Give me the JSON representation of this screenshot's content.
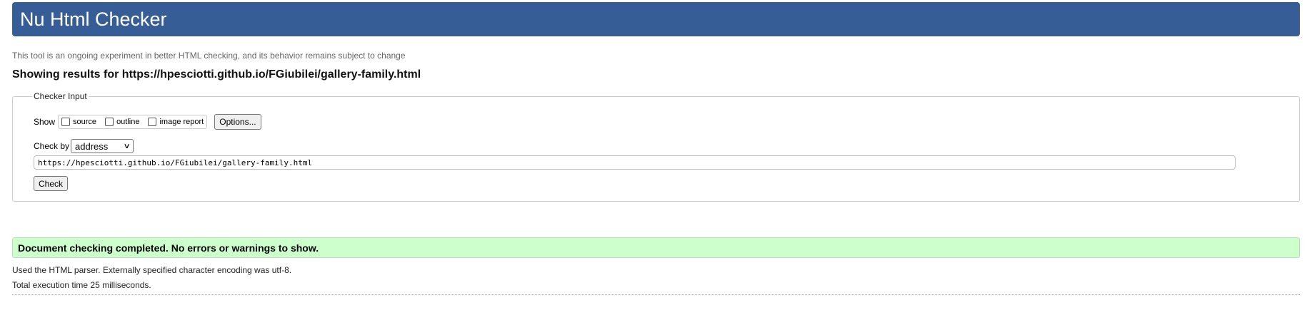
{
  "header": {
    "title": "Nu Html Checker",
    "subtitle": "This tool is an ongoing experiment in better HTML checking, and its behavior remains subject to change",
    "results_heading": "Showing results for https://hpesciotti.github.io/FGiubilei/gallery-family.html"
  },
  "checker_input": {
    "legend": "Checker Input",
    "show_label": "Show",
    "options": [
      {
        "label": "source",
        "checked": false
      },
      {
        "label": "outline",
        "checked": false
      },
      {
        "label": "image report",
        "checked": false
      }
    ],
    "options_button": "Options...",
    "check_by_label": "Check by",
    "check_by_value": "address",
    "url_value": "https://hpesciotti.github.io/FGiubilei/gallery-family.html",
    "check_button": "Check"
  },
  "results": {
    "success_message": "Document checking completed. No errors or warnings to show.",
    "parser_info": "Used the HTML parser. Externally specified character encoding was utf-8.",
    "execution_time": "Total execution time 25 milliseconds."
  },
  "colors": {
    "banner": "#365d95",
    "success_bg": "#ccffcc"
  }
}
